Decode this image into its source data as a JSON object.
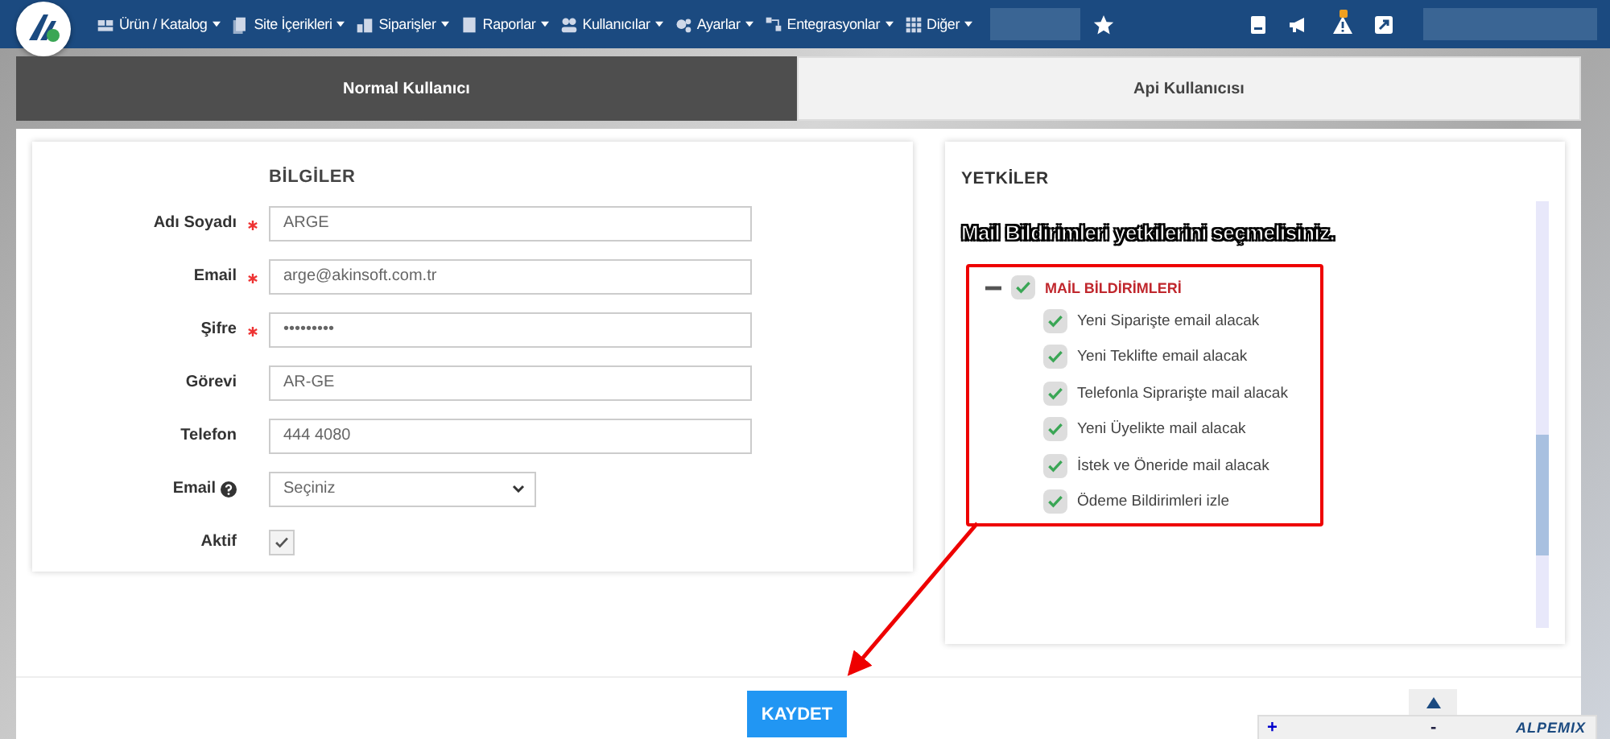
{
  "nav": {
    "menu": [
      {
        "label": "Ürün / Katalog"
      },
      {
        "label": "Site İçerikleri"
      },
      {
        "label": "Siparişler"
      },
      {
        "label": "Raporlar"
      },
      {
        "label": "Kullanıcılar"
      },
      {
        "label": "Ayarlar"
      },
      {
        "label": "Entegrasyonlar"
      },
      {
        "label": "Diğer"
      }
    ]
  },
  "tabs": [
    {
      "label": "Normal Kullanıcı",
      "selected": true
    },
    {
      "label": "Api Kullanıcısı",
      "selected": false
    }
  ],
  "form": {
    "title": "BİLGİLER",
    "fields": [
      {
        "kind": "text",
        "label": "Adı Soyadı",
        "required": true,
        "value": "ARGE"
      },
      {
        "kind": "text",
        "label": "Email",
        "required": true,
        "value": "arge@akinsoft.com.tr"
      },
      {
        "kind": "text",
        "label": "Şifre",
        "required": true,
        "value": "•••••••••"
      },
      {
        "kind": "text",
        "label": "Görevi",
        "required": false,
        "value": "AR-GE"
      },
      {
        "kind": "text",
        "label": "Telefon",
        "required": false,
        "value": "444 4080"
      },
      {
        "kind": "select",
        "label": "Email",
        "required": false,
        "help": true,
        "value": "Seçiniz"
      },
      {
        "kind": "checkbox",
        "label": "Aktif",
        "required": false,
        "checked": true
      }
    ]
  },
  "permissions": {
    "title": "YETKİLER",
    "note": "Mail Bildirimleri yetkilerini seçmelisiniz.",
    "group": {
      "label": "MAİL BİLDİRİMLERİ",
      "expanded": true,
      "checked": true,
      "children": [
        {
          "label": "Yeni Siparişte email alacak",
          "checked": true
        },
        {
          "label": "Yeni Teklifte email alacak",
          "checked": true
        },
        {
          "label": "Telefonla Siprarişte mail alacak",
          "checked": true
        },
        {
          "label": "Yeni Üyelikte mail alacak",
          "checked": true
        },
        {
          "label": "İstek ve Öneride mail alacak",
          "checked": true
        },
        {
          "label": "Ödeme Bildirimleri izle",
          "checked": true
        }
      ]
    }
  },
  "save_button": "KAYDET",
  "remote_bar": {
    "plus": "+",
    "minus": "-",
    "brand": "ALPEMIX"
  }
}
